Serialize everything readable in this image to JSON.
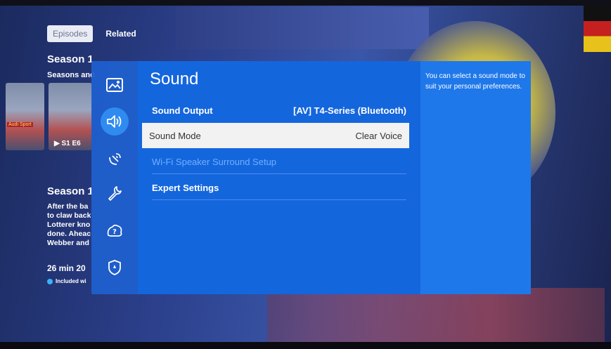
{
  "background": {
    "tabs": [
      {
        "label": "Episodes",
        "active": true
      },
      {
        "label": "Related",
        "active": false
      }
    ],
    "season_header": "Season 1",
    "season_subtitle": "Seasons and",
    "thumb_label": "▶ S1 E6",
    "thumb_tag": "Audi Sport",
    "season_detail_title": "Season 1",
    "description_lines": [
      "After the ba",
      "to claw back",
      "Lotterer kno",
      "done. Aheac",
      "Webber and"
    ],
    "meta": "26 min  20",
    "included": "Included wi"
  },
  "sidebar": {
    "items": [
      {
        "icon": "picture-icon",
        "active": false
      },
      {
        "icon": "sound-icon",
        "active": true
      },
      {
        "icon": "broadcasting-icon",
        "active": false
      },
      {
        "icon": "wrench-icon",
        "active": false
      },
      {
        "icon": "support-icon",
        "active": false
      },
      {
        "icon": "shield-icon",
        "active": false
      }
    ]
  },
  "panel": {
    "title": "Sound",
    "rows": {
      "sound_output": {
        "label": "Sound Output",
        "value": "[AV] T4-Series (Bluetooth)"
      },
      "sound_mode": {
        "label": "Sound Mode",
        "value": "Clear Voice"
      },
      "wifi_surround": {
        "label": "Wi-Fi Speaker Surround Setup"
      },
      "expert": {
        "label": "Expert Settings"
      }
    }
  },
  "help": {
    "text": "You can select a sound mode to suit your personal preferences."
  },
  "colors": {
    "panel": "#1466dd",
    "sidebar": "#1f5fcd",
    "help": "#1f78ea",
    "selected_row": "#f2f2f2",
    "disabled_text": "#6fb0ff"
  }
}
